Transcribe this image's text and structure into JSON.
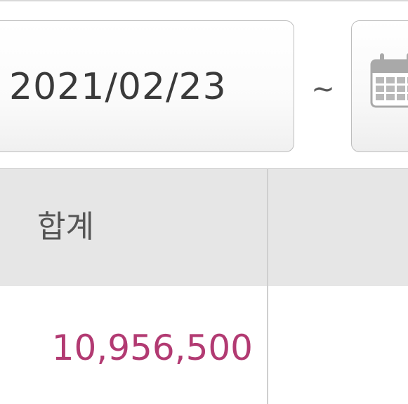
{
  "filter": {
    "start_date": "2021/02/23",
    "range_separator": "~",
    "calendar_icon": "calendar-icon"
  },
  "table": {
    "header": {
      "total_label": "합계"
    },
    "row": {
      "total_value": "10,956,500"
    }
  },
  "colors": {
    "value_accent": "#b23a72",
    "header_bg": "#e6e6e6",
    "icon_gray": "#a9a9a9"
  }
}
